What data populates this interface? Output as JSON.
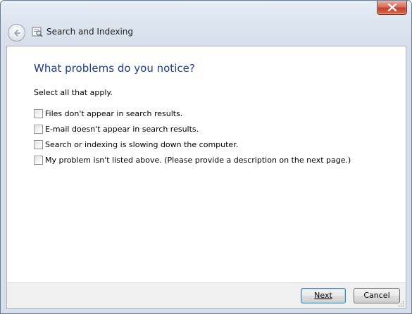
{
  "window": {
    "title": "Search and Indexing"
  },
  "toolbar": {
    "back_icon": "back-arrow-icon",
    "app_icon": "search-indexing-icon",
    "close_icon": "close-icon"
  },
  "main": {
    "heading": "What problems do you notice?",
    "instruction": "Select all that apply.",
    "options": [
      {
        "label": "Files don't appear in search results.",
        "checked": false
      },
      {
        "label": "E-mail doesn't appear in search results.",
        "checked": false
      },
      {
        "label": "Search or indexing is slowing down the computer.",
        "checked": false
      },
      {
        "label": "My problem isn't listed above. (Please provide a description on the next page.)",
        "checked": false
      }
    ]
  },
  "footer": {
    "next_label": "Next",
    "cancel_label": "Cancel"
  },
  "colors": {
    "heading": "#1f3d8a",
    "close_button": "#c4402a",
    "default_button_border": "#3c7fb1"
  }
}
